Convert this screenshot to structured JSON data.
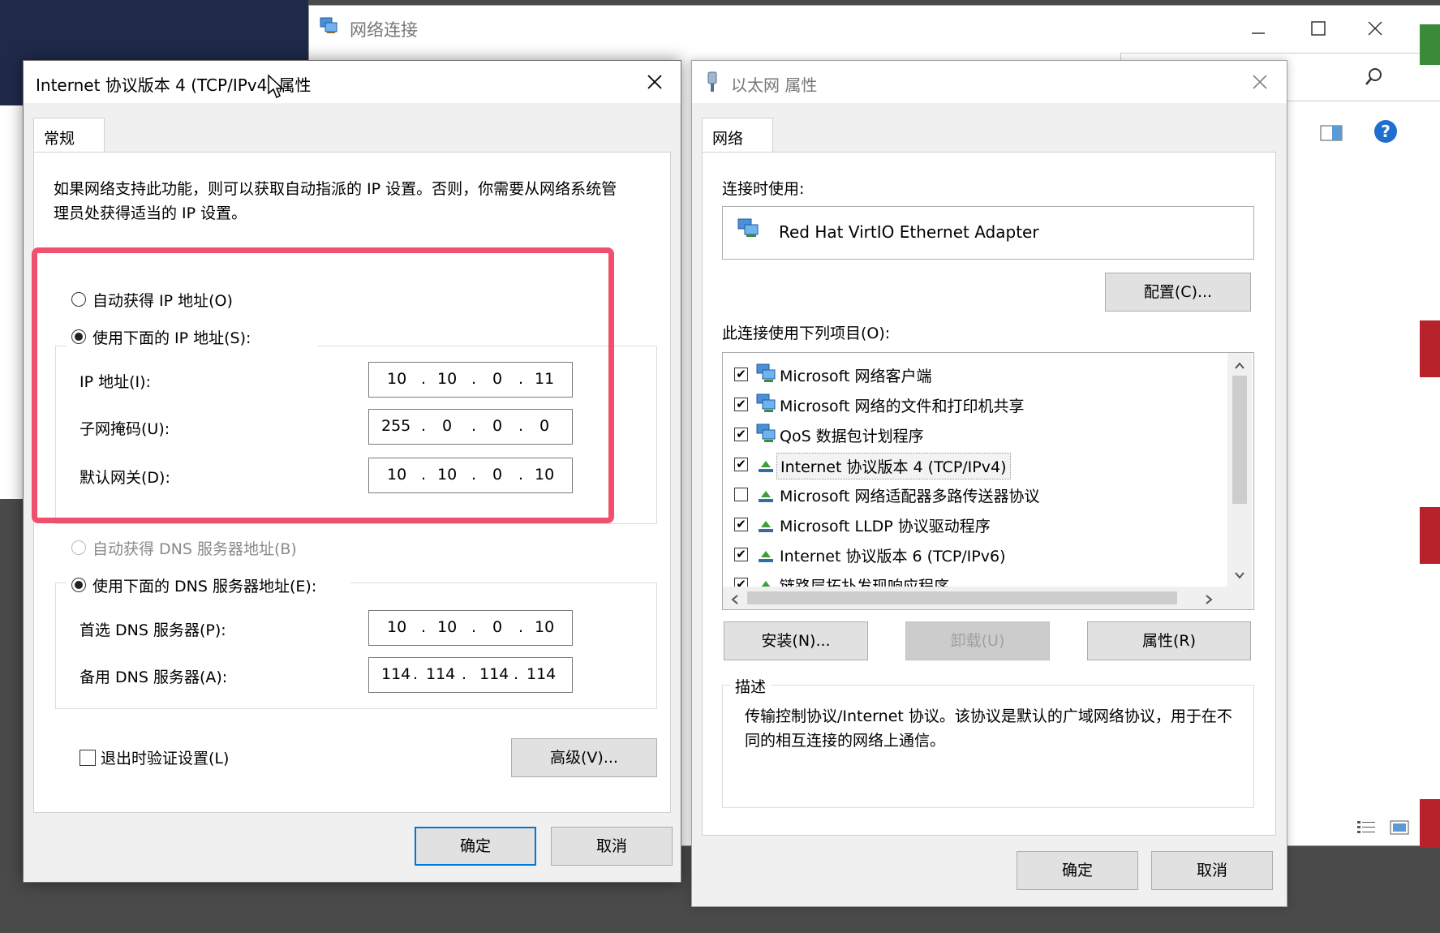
{
  "background_window": {
    "title": "网络连接"
  },
  "ipv4_dialog": {
    "title": "Internet 协议版本 4 (TCP/IPv4) 属性",
    "tab": "常规",
    "description": "如果网络支持此功能，则可以获取自动指派的 IP 设置。否则，你需要从网络系统管理员处获得适当的 IP 设置。",
    "auto_ip_label": "自动获得 IP 地址(O)",
    "manual_ip_label": "使用下面的 IP 地址(S):",
    "ip_label": "IP 地址(I):",
    "ip": [
      "10",
      "10",
      "0",
      "11"
    ],
    "mask_label": "子网掩码(U):",
    "mask": [
      "255",
      "0",
      "0",
      "0"
    ],
    "gateway_label": "默认网关(D):",
    "gateway": [
      "10",
      "10",
      "0",
      "10"
    ],
    "auto_dns_label": "自动获得 DNS 服务器地址(B)",
    "manual_dns_label": "使用下面的 DNS 服务器地址(E):",
    "pref_dns_label": "首选 DNS 服务器(P):",
    "pref_dns": [
      "10",
      "10",
      "0",
      "10"
    ],
    "alt_dns_label": "备用 DNS 服务器(A):",
    "alt_dns": [
      "114",
      "114",
      "114",
      "114"
    ],
    "validate_label": "退出时验证设置(L)",
    "advanced_button": "高级(V)...",
    "ok_button": "确定",
    "cancel_button": "取消",
    "highlight_color": "#f0506e"
  },
  "ethernet_dialog": {
    "title": "以太网 属性",
    "tab": "网络",
    "connect_using_label": "连接时使用:",
    "adapter": "Red Hat VirtIO Ethernet Adapter",
    "configure_button": "配置(C)...",
    "items_label": "此连接使用下列项目(O):",
    "items": [
      {
        "label": "Microsoft 网络客户端",
        "checked": true,
        "icon": "network-client-icon"
      },
      {
        "label": "Microsoft 网络的文件和打印机共享",
        "checked": true,
        "icon": "network-client-icon"
      },
      {
        "label": "QoS 数据包计划程序",
        "checked": true,
        "icon": "network-client-icon"
      },
      {
        "label": "Internet 协议版本 4 (TCP/IPv4)",
        "checked": true,
        "icon": "protocol-icon"
      },
      {
        "label": "Microsoft 网络适配器多路传送器协议",
        "checked": false,
        "icon": "protocol-icon"
      },
      {
        "label": "Microsoft LLDP 协议驱动程序",
        "checked": true,
        "icon": "protocol-icon"
      },
      {
        "label": "Internet 协议版本 6 (TCP/IPv6)",
        "checked": true,
        "icon": "protocol-icon"
      },
      {
        "label": "链路层拓扑发现响应程序",
        "checked": true,
        "icon": "protocol-icon"
      }
    ],
    "install_button": "安装(N)...",
    "uninstall_button": "卸载(U)",
    "properties_button": "属性(R)",
    "description_label": "描述",
    "description": "传输控制协议/Internet 协议。该协议是默认的广域网络协议，用于在不同的相互连接的网络上通信。",
    "ok_button": "确定",
    "cancel_button": "取消"
  }
}
